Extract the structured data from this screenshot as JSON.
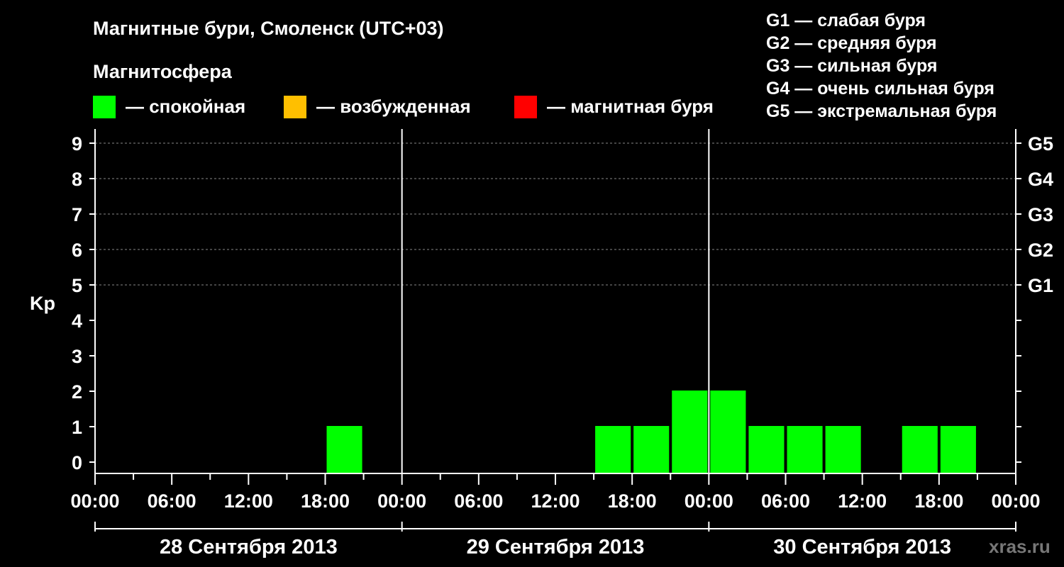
{
  "header": {
    "title": "Магнитные бури, Смоленск (UTC+03)",
    "subtitle": "Магнитосфера"
  },
  "legend": {
    "items": [
      {
        "label": "— спокойная",
        "color": "#00ff00"
      },
      {
        "label": "— возбужденная",
        "color": "#ffbf00"
      },
      {
        "label": "— магнитная буря",
        "color": "#ff0000"
      }
    ]
  },
  "g_legend": [
    "G1 — слабая буря",
    "G2 — средняя буря",
    "G3 — сильная буря",
    "G4 — очень сильная буря",
    "G5 — экстремальная буря"
  ],
  "watermark": "xras.ru",
  "chart_data": {
    "type": "bar",
    "ylabel": "Kp",
    "ylim": [
      0,
      9
    ],
    "yticks": [
      0,
      1,
      2,
      3,
      4,
      5,
      6,
      7,
      8,
      9
    ],
    "gscale": [
      {
        "label": "G1",
        "kp": 5
      },
      {
        "label": "G2",
        "kp": 6
      },
      {
        "label": "G3",
        "kp": 7
      },
      {
        "label": "G4",
        "kp": 8
      },
      {
        "label": "G5",
        "kp": 9
      }
    ],
    "xtick_labels": [
      "00:00",
      "06:00",
      "12:00",
      "18:00",
      "00:00",
      "06:00",
      "12:00",
      "18:00",
      "00:00",
      "06:00",
      "12:00",
      "18:00",
      "00:00"
    ],
    "days": [
      "28 Сентября 2013",
      "29 Сентября 2013",
      "30 Сентября 2013"
    ],
    "grid": "dashed horizontal lines at Kp 5-9",
    "series": [
      {
        "day": "28 Сентября 2013",
        "values": [
          null,
          null,
          null,
          null,
          null,
          null,
          1,
          null
        ]
      },
      {
        "day": "29 Сентября 2013",
        "values": [
          null,
          null,
          null,
          null,
          null,
          1,
          1,
          2
        ]
      },
      {
        "day": "30 Сентября 2013",
        "values": [
          2,
          1,
          1,
          1,
          null,
          1,
          1,
          null
        ]
      }
    ],
    "bar_color": "#00ff00"
  }
}
